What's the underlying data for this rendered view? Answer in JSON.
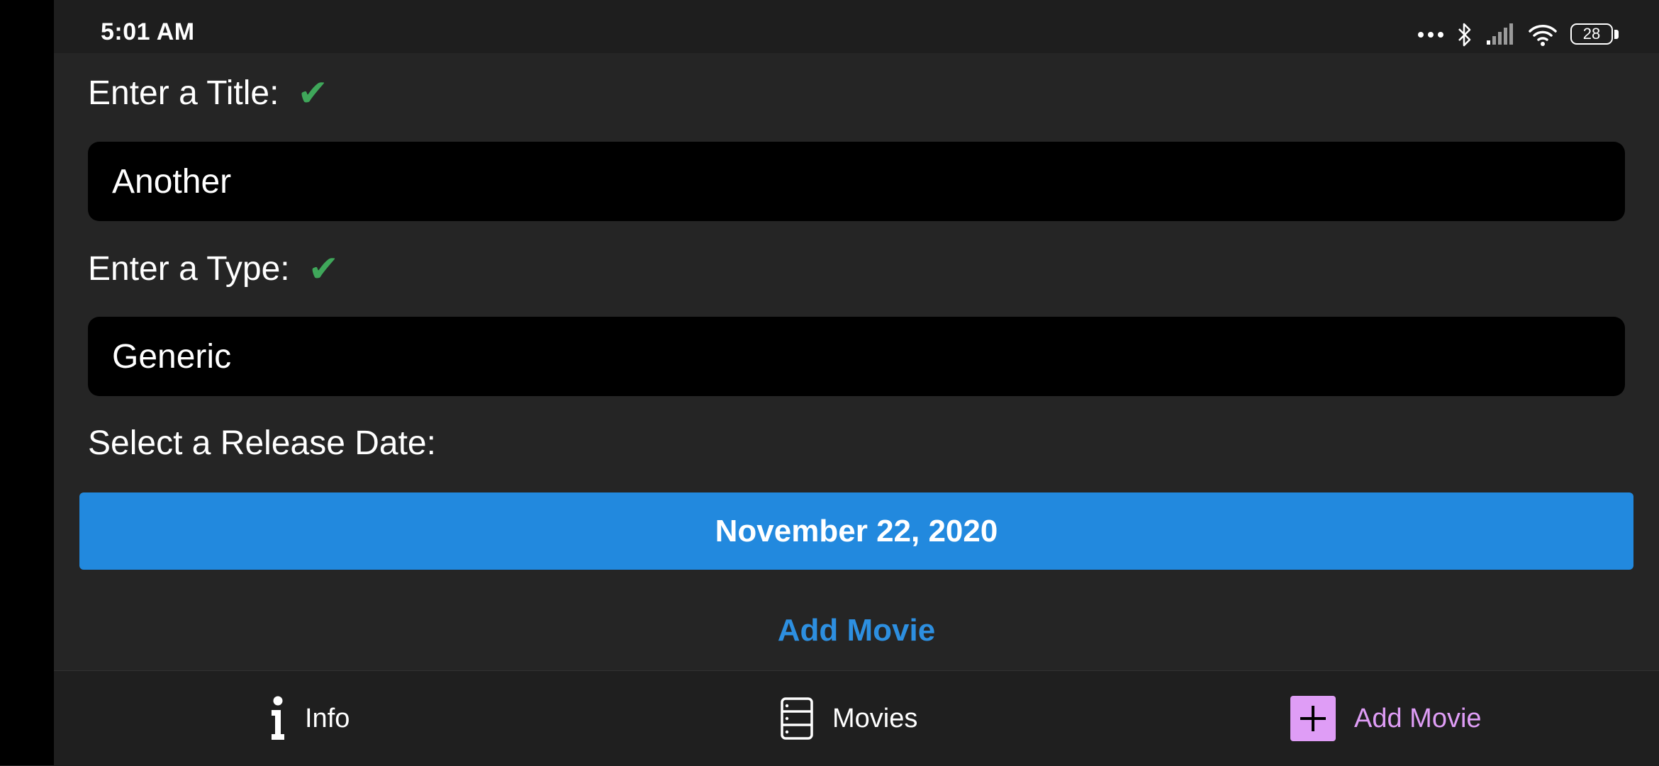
{
  "status_bar": {
    "time": "5:01 AM",
    "battery_level": "28"
  },
  "form": {
    "title_label": "Enter a Title:",
    "title_value": "Another",
    "type_label": "Enter a Type:",
    "type_value": "Generic",
    "release_date_label": "Select a Release Date:",
    "release_date_value": "November 22, 2020",
    "submit_label": "Add Movie",
    "valid_mark": "✔"
  },
  "bottom_nav": {
    "items": [
      {
        "label": "Info",
        "icon": "info-icon",
        "active": false
      },
      {
        "label": "Movies",
        "icon": "list-icon",
        "active": false
      },
      {
        "label": "Add Movie",
        "icon": "plus-icon",
        "active": true
      }
    ]
  },
  "colors": {
    "background": "#252525",
    "field_background": "#000000",
    "accent_blue": "#2289de",
    "check_green": "#3fa75a",
    "active_nav": "#df9df6"
  }
}
